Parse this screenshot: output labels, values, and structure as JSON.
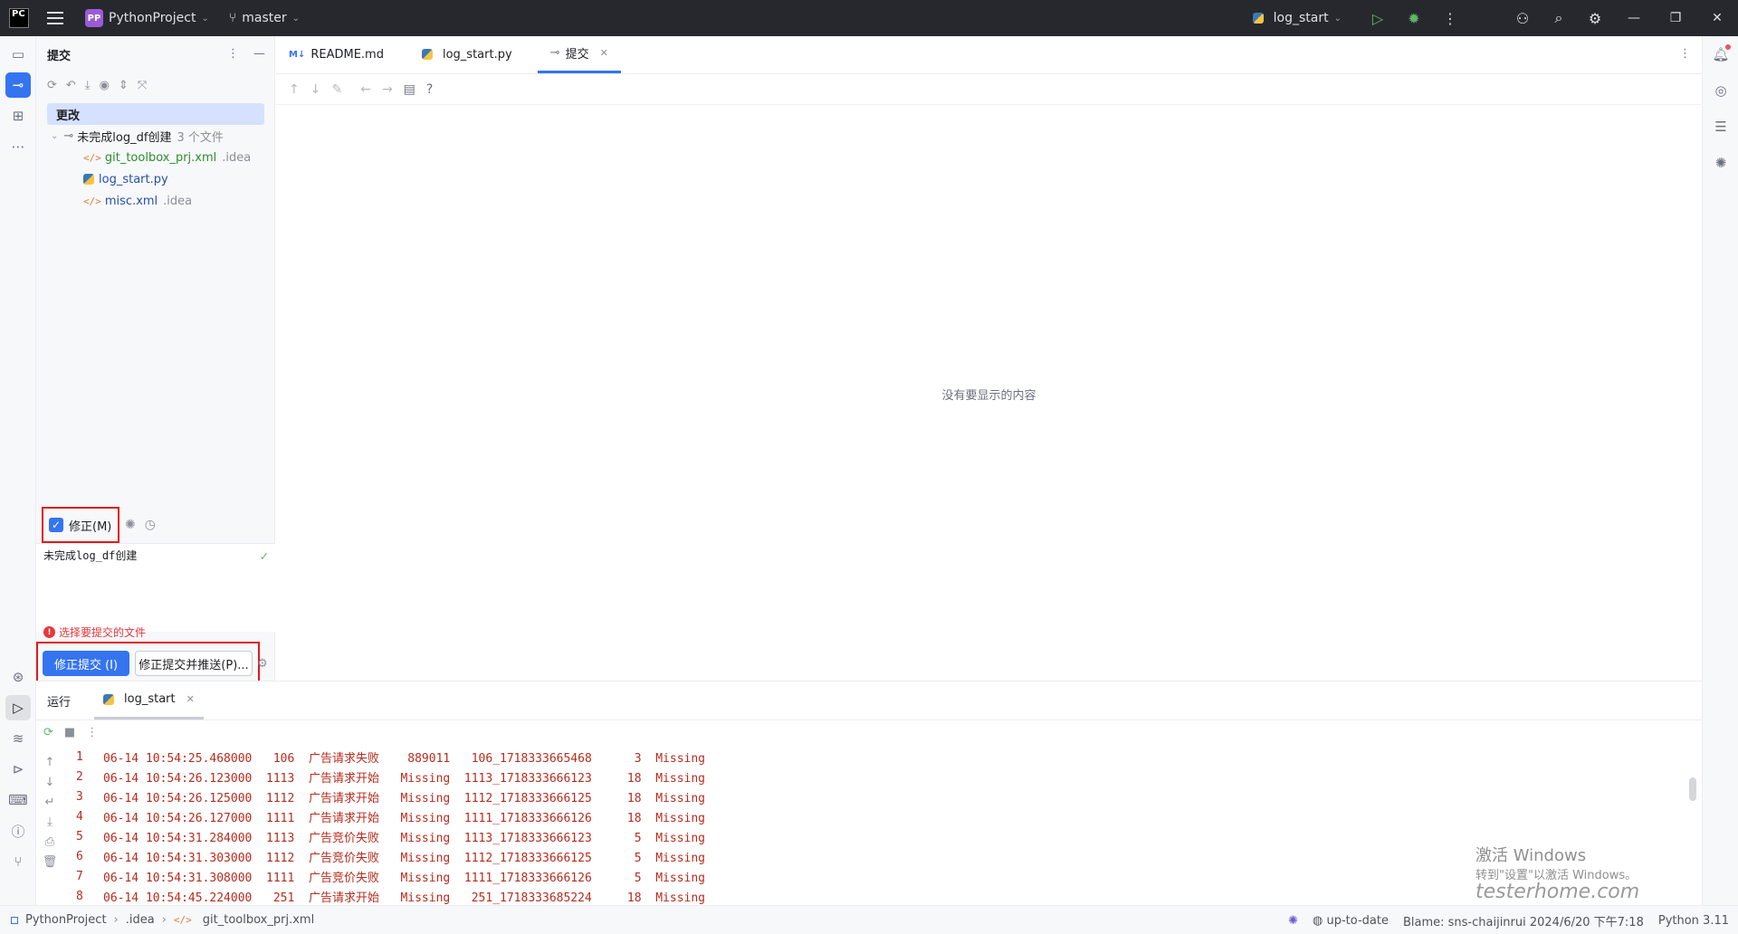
{
  "titlebar": {
    "app_badge": "PC",
    "project_badge": "PP",
    "project_name": "PythonProject",
    "branch": "master",
    "run_config": "log_start"
  },
  "commit_panel": {
    "title": "提交",
    "changes_group": "更改",
    "changelist_name": "未完成log_df创建",
    "changelist_count": "3 个文件",
    "files": [
      {
        "name": "git_toolbox_prj.xml",
        "dir": ".idea",
        "type": "xml"
      },
      {
        "name": "log_start.py",
        "dir": "",
        "type": "py"
      },
      {
        "name": "misc.xml",
        "dir": ".idea",
        "type": "xml"
      }
    ],
    "amend_label": "修正(M)",
    "commit_message": "未完成log_df创建",
    "error_text": "选择要提交的文件",
    "commit_button": "修正提交 (I)",
    "commit_push_button": "修正提交并推送(P)..."
  },
  "editor": {
    "tabs": [
      {
        "label": "README.md",
        "icon": "M↓"
      },
      {
        "label": "log_start.py",
        "icon": "py"
      },
      {
        "label": "提交",
        "icon": "commit"
      }
    ],
    "empty_message": "没有要显示的内容"
  },
  "run_panel": {
    "title": "运行",
    "tab_label": "log_start",
    "lines": [
      {
        "n": "1",
        "text": "06-14 10:54:25.468000   106  广告请求失败    889011   106_1718333665468      3  Missing"
      },
      {
        "n": "2",
        "text": "06-14 10:54:26.123000  1113  广告请求开始   Missing  1113_1718333666123     18  Missing"
      },
      {
        "n": "3",
        "text": "06-14 10:54:26.125000  1112  广告请求开始   Missing  1112_1718333666125     18  Missing"
      },
      {
        "n": "4",
        "text": "06-14 10:54:26.127000  1111  广告请求开始   Missing  1111_1718333666126     18  Missing"
      },
      {
        "n": "5",
        "text": "06-14 10:54:31.284000  1113  广告竞价失败   Missing  1113_1718333666123      5  Missing"
      },
      {
        "n": "6",
        "text": "06-14 10:54:31.303000  1112  广告竞价失败   Missing  1112_1718333666125      5  Missing"
      },
      {
        "n": "7",
        "text": "06-14 10:54:31.308000  1111  广告竞价失败   Missing  1111_1718333666126      5  Missing"
      },
      {
        "n": "8",
        "text": "06-14 10:54:45.224000   251  广告请求开始   Missing   251_1718333685224     18  Missing"
      }
    ]
  },
  "watermark": {
    "line1": "激活 Windows",
    "line2": "转到\"设置\"以激活 Windows。",
    "site": "testerhome.com"
  },
  "statusbar": {
    "breadcrumb": [
      "PythonProject",
      ".idea",
      "git_toolbox_prj.xml"
    ],
    "vcs_status": "up-to-date",
    "blame": "Blame: sns-chaijinrui 2024/6/20 下午7:18",
    "interpreter": "Python 3.11"
  }
}
